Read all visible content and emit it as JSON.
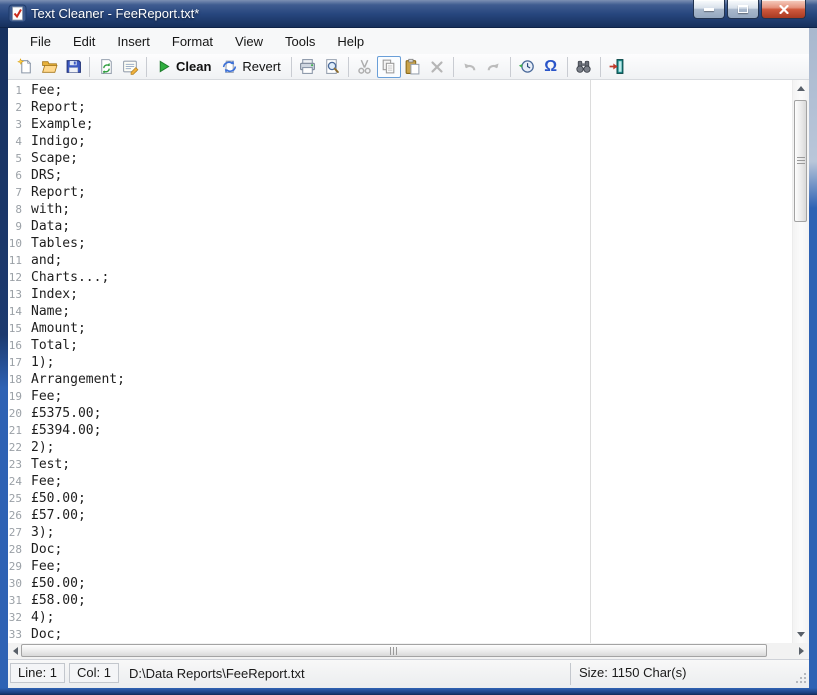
{
  "colors": {
    "titlebar_blue": "#27467e",
    "frame_accent_blue": "#2e62b4",
    "close_red": "#c0432b",
    "clean_green": "#2fae3f",
    "omega_blue": "#2a55c8"
  },
  "window": {
    "title": "Text Cleaner - FeeReport.txt*"
  },
  "menu": {
    "items": [
      "File",
      "Edit",
      "Insert",
      "Format",
      "View",
      "Tools",
      "Help"
    ]
  },
  "toolbar": {
    "clean_label": "Clean",
    "revert_label": "Revert",
    "omega_glyph": "Ω"
  },
  "editor": {
    "lines": [
      "Fee;",
      "Report;",
      "Example;",
      "Indigo;",
      "Scape;",
      "DRS;",
      "Report;",
      "with;",
      "Data;",
      "Tables;",
      "and;",
      "Charts...;",
      "Index;",
      "Name;",
      "Amount;",
      "Total;",
      "1);",
      "Arrangement;",
      "Fee;",
      "£5375.00;",
      "£5394.00;",
      "2);",
      "Test;",
      "Fee;",
      "£50.00;",
      "£57.00;",
      "3);",
      "Doc;",
      "Fee;",
      "£50.00;",
      "£58.00;",
      "4);",
      "Doc;"
    ]
  },
  "status": {
    "line": "Line: 1",
    "col": "Col: 1",
    "path": "D:\\Data Reports\\FeeReport.txt",
    "size": "Size: 1150 Char(s)"
  }
}
